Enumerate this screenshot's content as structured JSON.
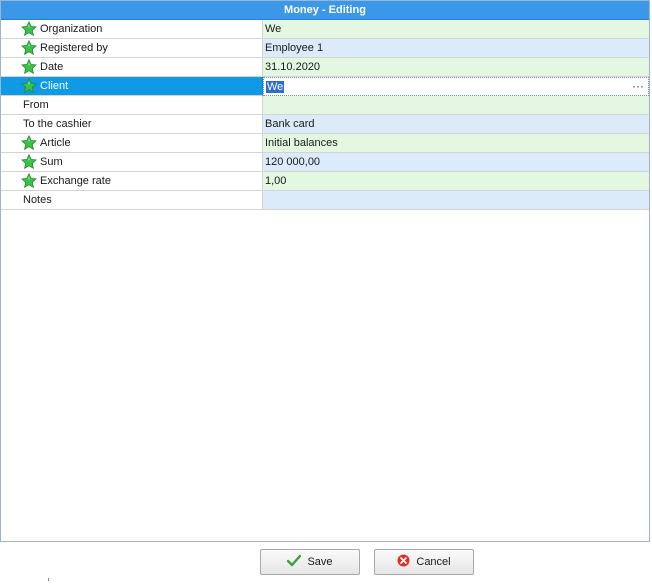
{
  "window": {
    "title": "Money - Editing"
  },
  "form": {
    "rows": [
      {
        "label": "Organization",
        "value": "We",
        "required": true,
        "value_bg": "green"
      },
      {
        "label": "Registered by",
        "value": "Employee 1",
        "required": true,
        "value_bg": "blue"
      },
      {
        "label": "Date",
        "value": "31.10.2020",
        "required": true,
        "value_bg": "green"
      },
      {
        "label": "Client",
        "value": "We",
        "required": true,
        "value_bg": "white",
        "selected": true,
        "ellipsis": "···"
      },
      {
        "label": "From",
        "value": "",
        "required": false,
        "value_bg": "green"
      },
      {
        "label": "To the cashier",
        "value": "Bank card",
        "required": false,
        "value_bg": "blue"
      },
      {
        "label": "Article",
        "value": "Initial balances",
        "required": true,
        "value_bg": "green"
      },
      {
        "label": "Sum",
        "value": "120 000,00",
        "required": true,
        "value_bg": "blue"
      },
      {
        "label": "Exchange rate",
        "value": "1,00",
        "required": true,
        "value_bg": "green"
      },
      {
        "label": "Notes",
        "value": "",
        "required": false,
        "value_bg": "blue"
      }
    ]
  },
  "buttons": {
    "save_label": "Save",
    "cancel_label": "Cancel"
  },
  "icons": {
    "required": "green-star-icon",
    "save": "check-icon",
    "cancel": "cancel-circle-icon"
  },
  "colors": {
    "title_bg": "#3b97e8",
    "selected_label_bg": "#0f9ae5",
    "green_cell": "#e4f8e1",
    "blue_cell": "#dcebfa"
  }
}
